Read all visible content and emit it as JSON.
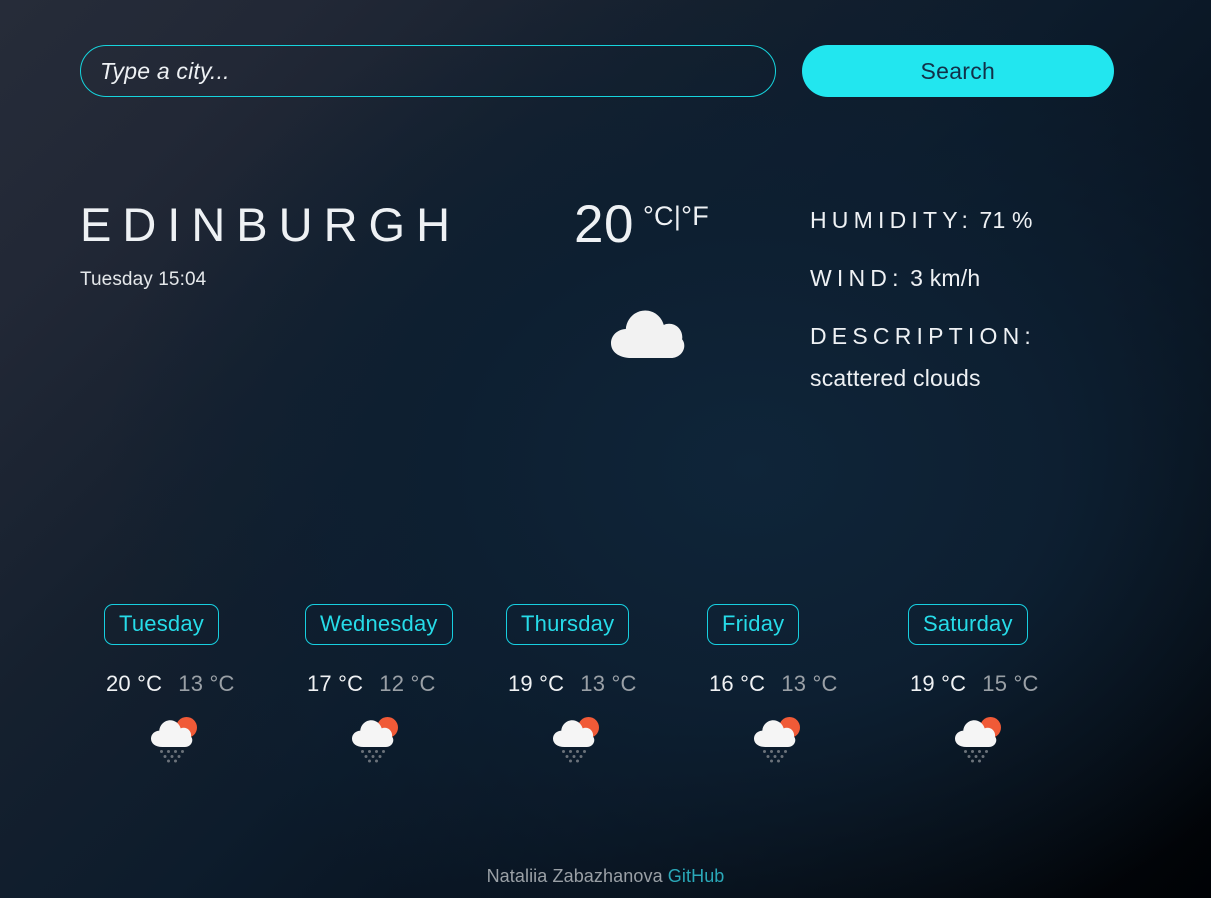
{
  "search": {
    "placeholder": "Type a city...",
    "value": "",
    "button_label": "Search"
  },
  "current": {
    "city": "EDINBURGH",
    "datetime": "Tuesday 15:04",
    "temperature": "20",
    "unit_toggle": "°C|°F",
    "icon": "cloud-icon",
    "humidity_label": "HUMIDITY:",
    "humidity_value": "71 %",
    "wind_label": "WIND:",
    "wind_value": "3 km/h",
    "description_label": "DESCRIPTION:",
    "description_value": "scattered clouds"
  },
  "forecast": [
    {
      "day": "Tuesday",
      "max": "20 °C",
      "min": "13 °C",
      "icon": "sun-cloud-drizzle-icon"
    },
    {
      "day": "Wednesday",
      "max": "17 °C",
      "min": "12 °C",
      "icon": "sun-cloud-drizzle-icon"
    },
    {
      "day": "Thursday",
      "max": "19 °C",
      "min": "13 °C",
      "icon": "sun-cloud-drizzle-icon"
    },
    {
      "day": "Friday",
      "max": "16 °C",
      "min": "13 °C",
      "icon": "sun-cloud-drizzle-icon"
    },
    {
      "day": "Saturday",
      "max": "19 °C",
      "min": "15 °C",
      "icon": "sun-cloud-drizzle-icon"
    }
  ],
  "footer": {
    "author": "Nataliia Zabazhanova",
    "link_label": "GitHub"
  },
  "colors": {
    "accent": "#22e6ef",
    "pill_border": "#17cfe0",
    "pill_text": "#26dbe8",
    "text_primary": "#eef1f4",
    "text_muted": "#9aa0a6",
    "link": "#2aa8b8",
    "sun": "#f05a37",
    "cloud": "#f2f2f2"
  }
}
